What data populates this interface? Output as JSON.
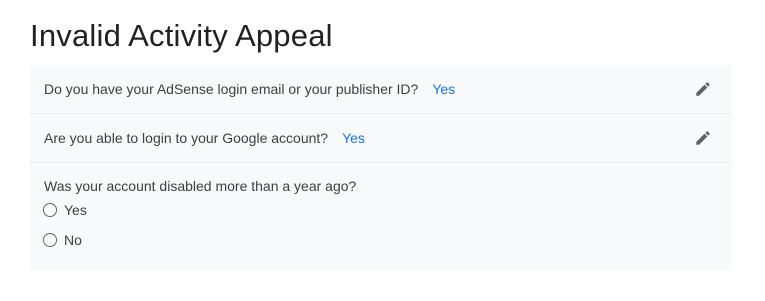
{
  "page": {
    "title": "Invalid Activity Appeal"
  },
  "questions": [
    {
      "text": "Do you have your AdSense login email or your publisher ID?",
      "answer": "Yes",
      "edit_icon": "pencil-icon"
    },
    {
      "text": "Are you able to login to your Google account?",
      "answer": "Yes",
      "edit_icon": "pencil-icon"
    },
    {
      "text": "Was your account disabled more than a year ago?",
      "options": [
        "Yes",
        "No"
      ],
      "selected": null
    }
  ],
  "colors": {
    "answer": "#1a73e8",
    "panel_bg": "#f8f9fa",
    "icon": "#5f6368"
  }
}
